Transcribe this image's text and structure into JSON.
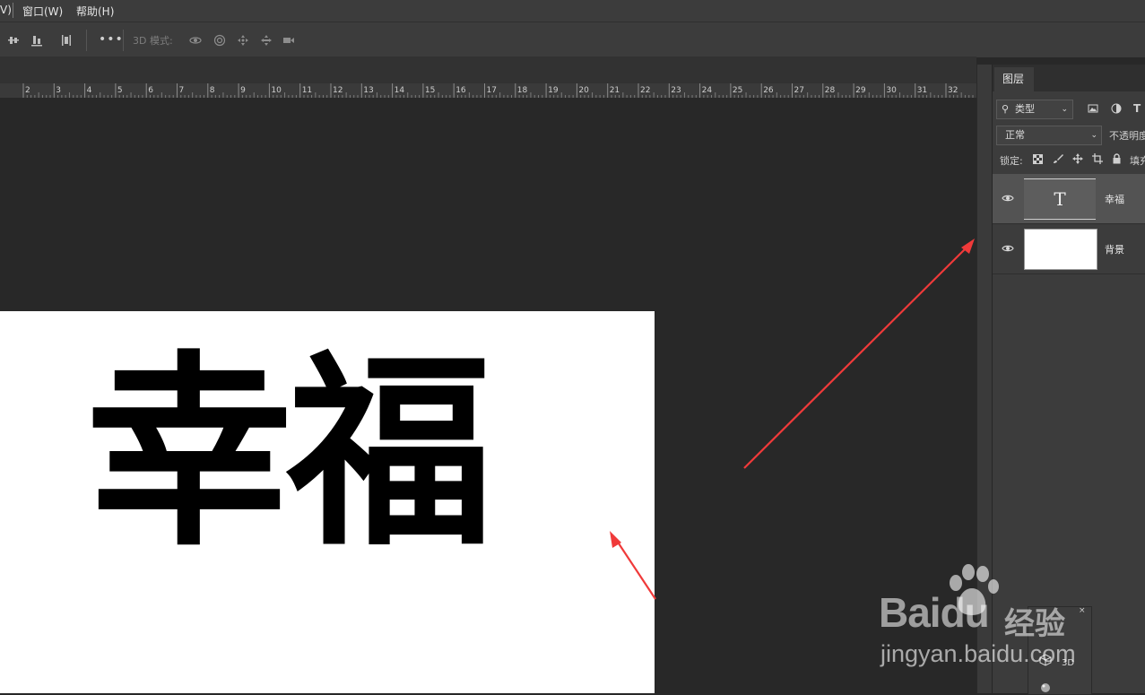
{
  "menubar": {
    "partial_item": "V)",
    "window": "窗口(W)",
    "help": "帮助(H)"
  },
  "optionsbar": {
    "more": "•••",
    "mode3d_label": "3D 模式:"
  },
  "ruler": {
    "ticks": [
      "2",
      "3",
      "4",
      "5",
      "6",
      "7",
      "8",
      "9",
      "10",
      "11",
      "12",
      "13",
      "14",
      "15",
      "16",
      "17",
      "18",
      "19",
      "20",
      "21",
      "22",
      "23",
      "24",
      "25",
      "26",
      "27",
      "28",
      "29",
      "30",
      "31",
      "32"
    ]
  },
  "document": {
    "text": "幸福"
  },
  "layers_panel": {
    "tab": "图层",
    "filter_kind": "类型",
    "blend_mode": "正常",
    "opacity_label": "不透明度",
    "lock_label": "锁定:",
    "fill_label": "填充",
    "layers": [
      {
        "name": "幸福",
        "type": "text",
        "thumb_glyph": "T",
        "selected": true
      },
      {
        "name": "背景",
        "type": "background",
        "selected": false
      }
    ]
  },
  "mini_panel": {
    "label_3d": "3D",
    "close": "×"
  },
  "watermark": {
    "brand": "Baidu",
    "cn": "经验",
    "url": "jingyan.baidu.com"
  },
  "colors": {
    "arrow": "#f03a3a",
    "selected_row": "#535353"
  }
}
